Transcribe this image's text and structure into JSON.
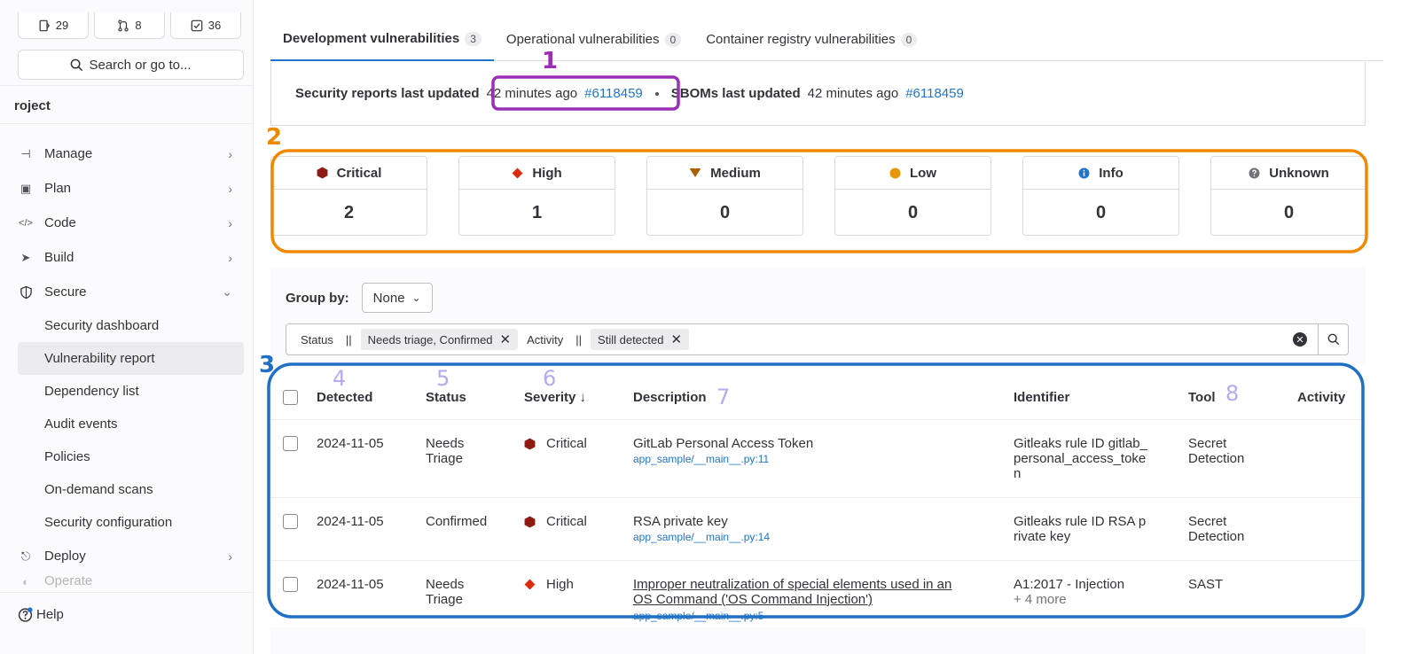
{
  "sidebar": {
    "counters": {
      "issues": "29",
      "merge_requests": "8",
      "todos": "36"
    },
    "search_label": "Search or go to...",
    "project_label": "roject",
    "nav": [
      {
        "label": "Manage",
        "icon": "users-icon"
      },
      {
        "label": "Plan",
        "icon": "calendar-icon"
      },
      {
        "label": "Code",
        "icon": "code-icon"
      },
      {
        "label": "Build",
        "icon": "rocket-icon"
      },
      {
        "label": "Secure",
        "icon": "shield-icon"
      }
    ],
    "secure_items": [
      "Security dashboard",
      "Vulnerability report",
      "Dependency list",
      "Audit events",
      "Policies",
      "On-demand scans",
      "Security configuration"
    ],
    "deploy_label": "Deploy",
    "operate_label": "Operate",
    "help_label": "Help"
  },
  "tabs": [
    {
      "label": "Development vulnerabilities",
      "count": "3"
    },
    {
      "label": "Operational vulnerabilities",
      "count": "0"
    },
    {
      "label": "Container registry vulnerabilities",
      "count": "0"
    }
  ],
  "reports": {
    "security_label": "Security reports last updated",
    "security_time": "42 minutes ago",
    "security_pipeline": "#6118459",
    "sbom_label": "SBOMs last updated",
    "sbom_time": "42 minutes ago",
    "sbom_pipeline": "#6118459"
  },
  "severity_counts": [
    {
      "label": "Critical",
      "value": "2",
      "color": "#8c1c13",
      "icon": "critical-hexagon-icon"
    },
    {
      "label": "High",
      "value": "1",
      "color": "#dd2b0e",
      "icon": "high-diamond-icon"
    },
    {
      "label": "Medium",
      "value": "0",
      "color": "#ab6100",
      "icon": "medium-triangle-icon"
    },
    {
      "label": "Low",
      "value": "0",
      "color": "#e9960c",
      "icon": "low-circle-icon"
    },
    {
      "label": "Info",
      "value": "0",
      "color": "#1f75cb",
      "icon": "info-icon"
    },
    {
      "label": "Unknown",
      "value": "0",
      "color": "#737278",
      "icon": "question-icon"
    }
  ],
  "groupby": {
    "label": "Group by:",
    "value": "None"
  },
  "filters": {
    "status_key": "Status",
    "op1": "||",
    "status_value": "Needs triage, Confirmed",
    "activity_key": "Activity",
    "op2": "||",
    "activity_value": "Still detected"
  },
  "table": {
    "headers": {
      "detected": "Detected",
      "status": "Status",
      "severity": "Severity ↓",
      "description": "Description",
      "identifier": "Identifier",
      "tool": "Tool",
      "activity": "Activity"
    },
    "rows": [
      {
        "detected": "2024-11-05",
        "status1": "Needs",
        "status2": "Triage",
        "severity": "Critical",
        "description": "GitLab Personal Access Token",
        "file": "app_sample/__main__.py:11",
        "id1": "Gitleaks rule ID gitlab_",
        "id2": "personal_access_toke",
        "id3": "n",
        "tool1": "Secret",
        "tool2": "Detection"
      },
      {
        "detected": "2024-11-05",
        "status1": "Confirmed",
        "status2": "",
        "severity": "Critical",
        "description": "RSA private key",
        "file": "app_sample/__main__.py:14",
        "id1": "Gitleaks rule ID RSA p",
        "id2": "rivate key",
        "id3": "",
        "tool1": "Secret",
        "tool2": "Detection"
      },
      {
        "detected": "2024-11-05",
        "status1": "Needs",
        "status2": "Triage",
        "severity": "High",
        "description1": "Improper neutralization of special elements used in an",
        "description2": "OS Command ('OS Command Injection')",
        "file": "app_sample/__main__.py:5",
        "id1": "A1:2017 - Injection",
        "id2": "+ 4 more",
        "tool1": "SAST",
        "tool2": ""
      }
    ]
  },
  "annotations": {
    "n1": "1",
    "n2": "2",
    "n3": "3",
    "n4": "4",
    "n5": "5",
    "n6": "6",
    "n7": "7",
    "n8": "8",
    "purple": "#9b30b5",
    "orange": "#ef8a00",
    "blue": "#1f6fc5",
    "lavender": "#b8a9f0"
  }
}
